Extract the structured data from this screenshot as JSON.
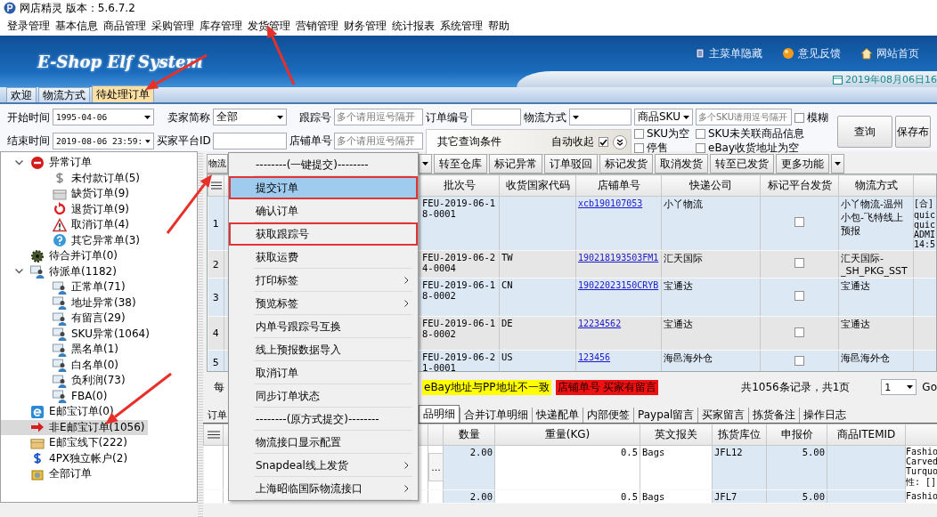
{
  "window": {
    "title": "网店精灵 版本：5.6.7.2"
  },
  "menu_bar": [
    "登录管理",
    "基本信息",
    "商品管理",
    "采购管理",
    "库存管理",
    "发货管理",
    "营销管理",
    "财务管理",
    "统计报表",
    "系统管理",
    "帮助"
  ],
  "banner": {
    "logo": "E-Shop Elf System",
    "links": [
      "主菜单隐藏",
      "意见反馈",
      "网站首页"
    ],
    "date": "2019年08月06日16"
  },
  "tabs": [
    {
      "label": "欢迎",
      "selected": false
    },
    {
      "label": "物流方式",
      "selected": false
    },
    {
      "label": "待处理订单",
      "selected": true
    }
  ],
  "filters": {
    "start_time": {
      "label": "开始时间",
      "value": "1995-04-06"
    },
    "seller": {
      "label": "卖家简称",
      "value": "全部"
    },
    "tracking_no": {
      "label": "跟踪号",
      "placeholder": "多个请用逗号隔开"
    },
    "order_no": {
      "label": "订单编号"
    },
    "shipping_method": {
      "label": "物流方式"
    },
    "end_time": {
      "label": "结束时间",
      "value": "2019-08-06 23:59:"
    },
    "buyer_id": {
      "label": "买家平台ID"
    },
    "shop_order_no": {
      "label": "店铺单号",
      "placeholder": "多个请用逗号隔开"
    },
    "other_conditions": {
      "label": "其它查询条件",
      "auto_collapse": {
        "label": "自动收起",
        "checked": true
      }
    },
    "sku_type": {
      "value": "商品SKU"
    },
    "sku": {
      "placeholder": "多个SKU请用逗号隔开"
    },
    "checkboxes": [
      {
        "label": "模糊",
        "checked": false
      },
      {
        "label": "SKU为空",
        "checked": false
      },
      {
        "label": "停售",
        "checked": false
      },
      {
        "label": "SKU未关联商品信息",
        "checked": false
      },
      {
        "label": "eBay收货地址为空",
        "checked": false
      }
    ],
    "buttons": [
      "查询",
      "保存布"
    ]
  },
  "tree": [
    {
      "label": "异常订单",
      "expanded": true,
      "selected": false,
      "children": [
        {
          "label": "未付款订单(5)",
          "selected": false
        },
        {
          "label": "缺货订单(9)",
          "selected": false
        },
        {
          "label": "退货订单(9)",
          "selected": false
        },
        {
          "label": "取消订单(4)",
          "selected": false
        },
        {
          "label": "其它异常单(3)",
          "selected": false
        }
      ]
    },
    {
      "label": "待合并订单(0)",
      "selected": false
    },
    {
      "label": "待派单(1182)",
      "expanded": true,
      "selected": false,
      "children": [
        {
          "label": "正常单(71)",
          "selected": false
        },
        {
          "label": "地址异常(38)",
          "selected": false
        },
        {
          "label": "有留言(29)",
          "selected": false
        },
        {
          "label": "SKU异常(1064)",
          "selected": false
        },
        {
          "label": "黑名单(1)",
          "selected": false
        },
        {
          "label": "白名单(0)",
          "selected": false
        },
        {
          "label": "负利润(73)",
          "selected": false
        },
        {
          "label": "FBA(0)",
          "selected": false
        }
      ]
    },
    {
      "label": "E邮宝订单(0)",
      "selected": false
    },
    {
      "label": "非E邮宝订单(1056)",
      "selected": true
    },
    {
      "label": "E邮宝线下(222)",
      "selected": false
    },
    {
      "label": "4PX独立帐户(2)",
      "selected": false
    },
    {
      "label": "全部订单",
      "selected": false
    }
  ],
  "toolbar": {
    "buttons": [
      {
        "kind": "button",
        "label": "物流"
      },
      {
        "kind": "dropdown"
      },
      {
        "kind": "button",
        "label": "转至仓库"
      },
      {
        "kind": "button",
        "label": "标记异常"
      },
      {
        "kind": "button",
        "label": "订单驳回"
      },
      {
        "kind": "button",
        "label": "标记发货"
      },
      {
        "kind": "button",
        "label": "取消发货"
      },
      {
        "kind": "button",
        "label": "转至已发货"
      },
      {
        "kind": "button",
        "label": "更多功能"
      },
      {
        "kind": "dropdown"
      }
    ]
  },
  "context_menu": {
    "items": [
      {
        "kind": "heading",
        "label": "--------(一键提交)--------"
      },
      {
        "kind": "item",
        "label": "提交订单",
        "selected": true,
        "submenu": false,
        "annotated": true
      },
      {
        "kind": "item",
        "label": "确认订单",
        "selected": false,
        "submenu": false,
        "annotated": false
      },
      {
        "kind": "item",
        "label": "获取跟踪号",
        "selected": false,
        "submenu": false,
        "annotated": true
      },
      {
        "kind": "item",
        "label": "获取运费",
        "selected": false,
        "submenu": false,
        "annotated": false
      },
      {
        "kind": "item",
        "label": "打印标签",
        "selected": false,
        "submenu": true,
        "annotated": false
      },
      {
        "kind": "item",
        "label": "预览标签",
        "selected": false,
        "submenu": true,
        "annotated": false
      },
      {
        "kind": "item",
        "label": "内单号跟踪号互换",
        "selected": false,
        "submenu": false,
        "annotated": false
      },
      {
        "kind": "item",
        "label": "线上预报数据导入",
        "selected": false,
        "submenu": false,
        "annotated": false
      },
      {
        "kind": "item",
        "label": "取消订单",
        "selected": false,
        "submenu": false,
        "annotated": false
      },
      {
        "kind": "item",
        "label": "同步订单状态",
        "selected": false,
        "submenu": false,
        "annotated": false
      },
      {
        "kind": "heading",
        "label": "--------(原方式提交)--------"
      },
      {
        "kind": "item",
        "label": "物流接口显示配置",
        "selected": false,
        "submenu": false,
        "annotated": false
      },
      {
        "kind": "item",
        "label": "Snapdeal线上发货",
        "selected": false,
        "submenu": true,
        "annotated": false
      },
      {
        "kind": "item",
        "label": "上海昭临国际物流接口",
        "selected": false,
        "submenu": true,
        "annotated": false
      }
    ]
  },
  "orders_table": {
    "columns": [
      "批次号",
      "收货国家代码",
      "店铺单号",
      "快递公司",
      "标记平台发货",
      "物流方式"
    ],
    "rows": [
      {
        "no": "1",
        "batch": "FEU-2019-06-18-0001",
        "shop_order_no": "xcb190107053",
        "courier": "小丫物流",
        "platform_shipped": false,
        "shipping_method": "小丫物流-温州小包-飞特线上预报",
        "column_9": [
          "[合]",
          "quic",
          "quic",
          "ADMI",
          "14:5"
        ]
      },
      {
        "no": "2",
        "batch": "FEU-2019-06-24-0004",
        "country": "TW",
        "shop_order_no": "190218193503FM1",
        "courier": "汇天国际",
        "platform_shipped": false,
        "shipping_method": "汇天国际-_SH_PKG_SST"
      },
      {
        "no": "3",
        "batch": "FEU-2019-06-18-0002",
        "country": "CN",
        "shop_order_no": "19022023150CRYB",
        "courier": "宝通达",
        "platform_shipped": false,
        "shipping_method": "宝通达"
      },
      {
        "no": "4",
        "batch": "FEU-2019-06-18-0002",
        "country": "DE",
        "shop_order_no": "12234562",
        "courier": "宝通达",
        "platform_shipped": false,
        "shipping_method": "宝通达"
      },
      {
        "no": "5",
        "batch": "FEU-2019-06-21-0001",
        "country": "US",
        "shop_order_no": "123456",
        "courier": "海邑海外仓",
        "platform_shipped": false,
        "shipping_method": "海邑海外仓"
      }
    ]
  },
  "status_bar": {
    "per_page_label": "每",
    "legend": [
      {
        "label": "eBay地址与PP地址不一致",
        "color": "#ffff00"
      },
      {
        "label": "店铺单号 买家有留言",
        "color": "#ee1111"
      }
    ],
    "record_count": "共1056条记录，共1页",
    "page": "1",
    "go": "Go"
  },
  "detail_tabs": [
    {
      "label": "订单",
      "selected": false
    },
    {
      "label": "品明细",
      "selected": true
    },
    {
      "label": "合并订单明细",
      "selected": false
    },
    {
      "label": "快递配单",
      "selected": false
    },
    {
      "label": "内部便签",
      "selected": false
    },
    {
      "label": "Paypal留言",
      "selected": false
    },
    {
      "label": "买家留言",
      "selected": false
    },
    {
      "label": "拣货备注",
      "selected": false
    },
    {
      "label": "操作日志",
      "selected": false
    }
  ],
  "detail_table": {
    "columns": [
      "数量",
      "重量(KG)",
      "英文报关",
      "拣货库位",
      "申报价",
      "商品ITEMID"
    ],
    "rows": [
      {
        "button": "...",
        "quantity": "2.00",
        "weight": "0.5",
        "customs_name": "Bags",
        "pick_location": "JFL12",
        "declared_value": "5.00",
        "column_10": [
          "Fashio",
          "Carved",
          "Turquo",
          "性: []"
        ]
      },
      {
        "quantity": "2.00",
        "weight": "0.5",
        "customs_name": "Bags",
        "pick_location": "JFL7",
        "declared_value": "5.00",
        "column_10": [
          "Fashio"
        ]
      }
    ]
  }
}
